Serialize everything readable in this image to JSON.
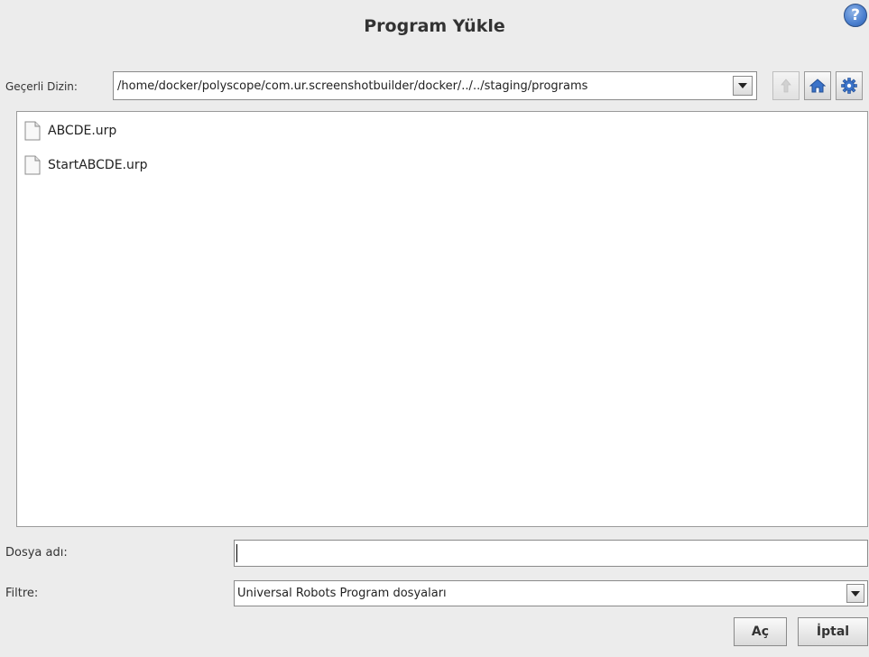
{
  "dialog": {
    "title": "Program Yükle",
    "help_symbol": "?"
  },
  "directory": {
    "label": "Geçerli Dizin:",
    "current_path": "/home/docker/polyscope/com.ur.screenshotbuilder/docker/../../staging/programs"
  },
  "toolbar": {
    "up_icon": "arrow-up-icon",
    "home_icon": "home-icon",
    "settings_icon": "gear-icon"
  },
  "files": [
    {
      "name": "ABCDE.urp",
      "icon": "file-icon"
    },
    {
      "name": "StartABCDE.urp",
      "icon": "file-icon"
    }
  ],
  "filename": {
    "label": "Dosya adı:",
    "value": ""
  },
  "filter": {
    "label": "Filtre:",
    "selected": "Universal Robots Program dosyaları"
  },
  "buttons": {
    "open_label": "Aç",
    "cancel_label": "İptal"
  },
  "colors": {
    "background": "#ececec",
    "help_blue": "#4a7fcf",
    "home_blue": "#3b73c9"
  }
}
